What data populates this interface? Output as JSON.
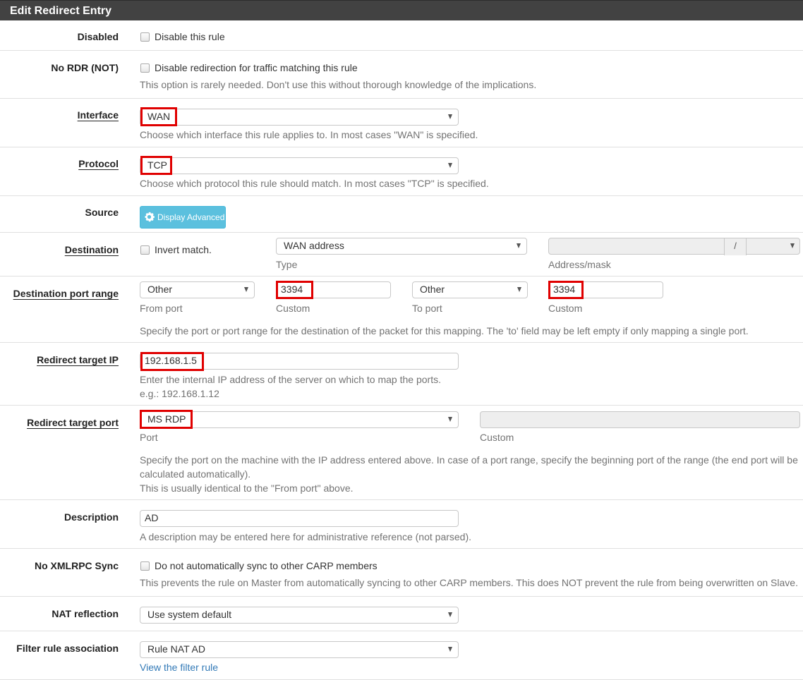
{
  "panel": {
    "title": "Edit Redirect Entry"
  },
  "colors": {
    "header_bg": "#424242",
    "highlight": "#e00000",
    "button_info": "#5bc0de",
    "link": "#337ab7"
  },
  "rows": {
    "disabled": {
      "label": "Disabled",
      "checkbox_label": "Disable this rule",
      "checked": false
    },
    "nordr": {
      "label": "No RDR (NOT)",
      "checkbox_label": "Disable redirection for traffic matching this rule",
      "checked": false,
      "help": "This option is rarely needed. Don't use this without thorough knowledge of the implications."
    },
    "interface": {
      "label": "Interface",
      "value": "WAN",
      "help": "Choose which interface this rule applies to. In most cases \"WAN\" is specified."
    },
    "protocol": {
      "label": "Protocol",
      "value": "TCP",
      "help": "Choose which protocol this rule should match. In most cases \"TCP\" is specified."
    },
    "source": {
      "label": "Source",
      "button": "Display Advanced",
      "button_icon": "gear-icon"
    },
    "destination": {
      "label": "Destination",
      "invert_label": "Invert match.",
      "invert_checked": false,
      "type_value": "WAN address",
      "type_sub": "Type",
      "address_value": "",
      "mask_separator": "/",
      "mask_value": "",
      "address_sub": "Address/mask"
    },
    "dest_port": {
      "label": "Destination port range",
      "from_value": "Other",
      "from_sub": "From port",
      "from_custom": "3394",
      "from_custom_sub": "Custom",
      "to_value": "Other",
      "to_sub": "To port",
      "to_custom": "3394",
      "to_custom_sub": "Custom",
      "help": "Specify the port or port range for the destination of the packet for this mapping. The 'to' field may be left empty if only mapping a single port."
    },
    "target_ip": {
      "label": "Redirect target IP",
      "value": "192.168.1.5",
      "help1": "Enter the internal IP address of the server on which to map the ports.",
      "help2": "e.g.: 192.168.1.12"
    },
    "target_port": {
      "label": "Redirect target port",
      "value": "MS RDP",
      "sub": "Port",
      "custom_value": "",
      "custom_sub": "Custom",
      "help1": "Specify the port on the machine with the IP address entered above. In case of a port range, specify the beginning port of the range (the end port will be",
      "help2": "calculated automatically).",
      "help3": "This is usually identical to the \"From port\" above."
    },
    "description": {
      "label": "Description",
      "value": "AD",
      "help": "A description may be entered here for administrative reference (not parsed)."
    },
    "xmlrpc": {
      "label": "No XMLRPC Sync",
      "checkbox_label": "Do not automatically sync to other CARP members",
      "checked": false,
      "help": "This prevents the rule on Master from automatically syncing to other CARP members. This does NOT prevent the rule from being overwritten on Slave."
    },
    "nat_reflection": {
      "label": "NAT reflection",
      "value": "Use system default"
    },
    "filter_assoc": {
      "label": "Filter rule association",
      "value": "Rule NAT AD",
      "link": "View the filter rule"
    }
  }
}
